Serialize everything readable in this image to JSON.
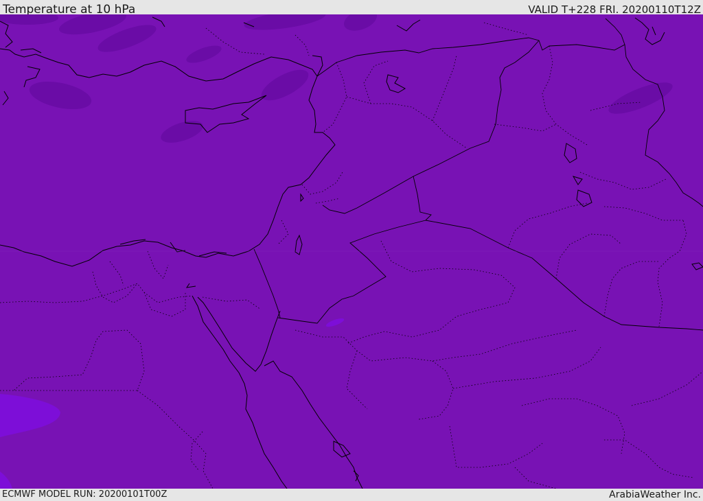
{
  "header": {
    "title": "Temperature at 10 hPa",
    "valid": "VALID T+228 FRI. 20200110T12Z"
  },
  "footer": {
    "model_run": "ECMWF MODEL RUN: 20200101T00Z",
    "brand": "ArabiaWeather Inc."
  },
  "map": {
    "colors": {
      "background": "#7812b4",
      "darker_anomaly": "#6a0ca6",
      "lighter_anomaly": "#7d0ed8",
      "borders": "#000000"
    }
  }
}
